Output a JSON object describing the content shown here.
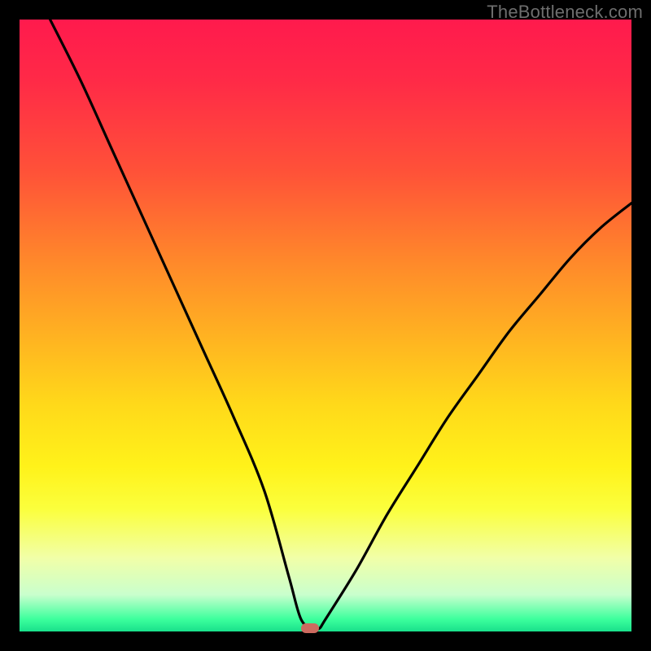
{
  "watermark": "TheBottleneck.com",
  "chart_data": {
    "type": "line",
    "title": "",
    "xlabel": "",
    "ylabel": "",
    "xlim": [
      0,
      100
    ],
    "ylim": [
      0,
      100
    ],
    "grid": false,
    "legend": false,
    "series": [
      {
        "name": "bottleneck-curve",
        "x": [
          5,
          10,
          15,
          20,
          25,
          30,
          35,
          40,
          44,
          46,
          48,
          49,
          50,
          55,
          60,
          65,
          70,
          75,
          80,
          85,
          90,
          95,
          100
        ],
        "y": [
          100,
          90,
          79,
          68,
          57,
          46,
          35,
          23,
          9,
          2,
          0.5,
          0.5,
          2,
          10,
          19,
          27,
          35,
          42,
          49,
          55,
          61,
          66,
          70
        ]
      }
    ],
    "minimum_marker": {
      "x": 47.5,
      "y": 0.5
    },
    "gradient_stops": [
      {
        "pos": 0,
        "color": "#ff1a4d"
      },
      {
        "pos": 10,
        "color": "#ff2a47"
      },
      {
        "pos": 25,
        "color": "#ff5238"
      },
      {
        "pos": 40,
        "color": "#ff8a2a"
      },
      {
        "pos": 52,
        "color": "#ffb321"
      },
      {
        "pos": 63,
        "color": "#ffd91a"
      },
      {
        "pos": 73,
        "color": "#fff21a"
      },
      {
        "pos": 80,
        "color": "#fbff3d"
      },
      {
        "pos": 88,
        "color": "#f1ffa8"
      },
      {
        "pos": 94,
        "color": "#c9ffcd"
      },
      {
        "pos": 98,
        "color": "#3cff9d"
      },
      {
        "pos": 100,
        "color": "#19e08b"
      }
    ]
  }
}
